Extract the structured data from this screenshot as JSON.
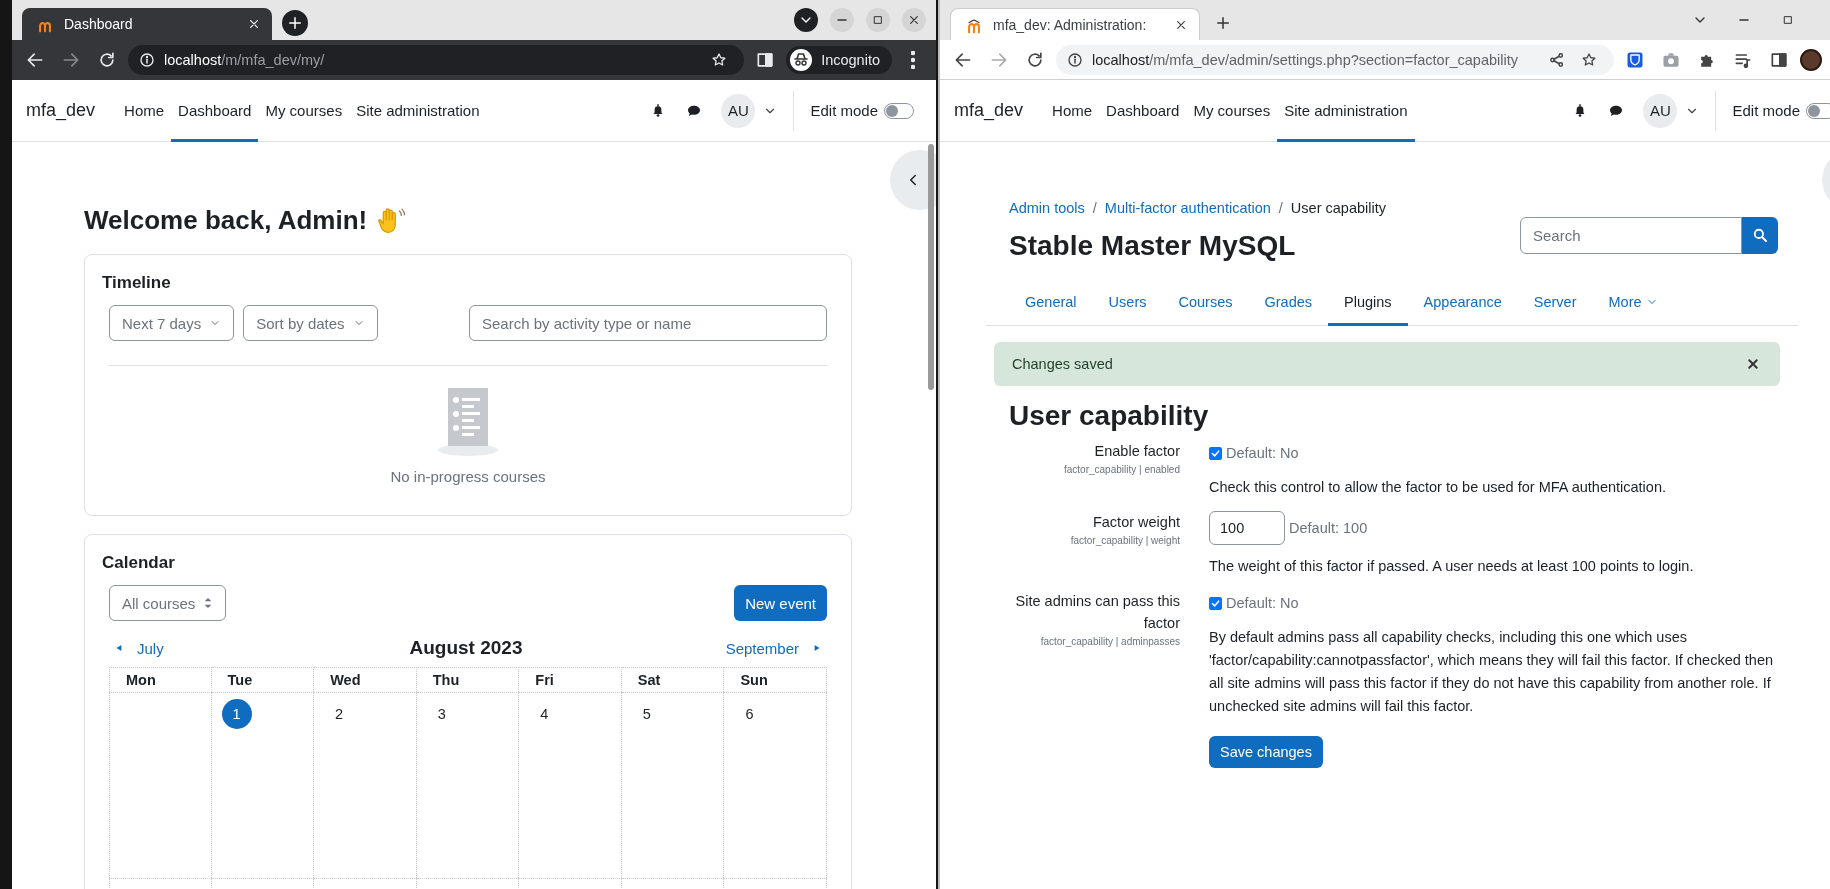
{
  "left_window": {
    "incognito": true,
    "tab": {
      "title": "Dashboard"
    },
    "address": {
      "host": "localhost",
      "path": "/m/mfa_dev/my/"
    },
    "profile_label": "Incognito",
    "navbar": {
      "site_name": "mfa_dev",
      "nav": [
        {
          "label": "Home",
          "selected": false
        },
        {
          "label": "Dashboard",
          "selected": true
        },
        {
          "label": "My courses",
          "selected": false
        },
        {
          "label": "Site administration",
          "selected": false
        }
      ],
      "avatar": "AU",
      "edit_mode": {
        "label": "Edit mode",
        "on": false
      }
    },
    "page": {
      "heading": "Welcome back, Admin!",
      "timeline": {
        "title": "Timeline",
        "filters": [
          "Next 7 days",
          "Sort by dates"
        ],
        "search": {
          "placeholder": "Search by activity type or name"
        },
        "empty_text": "No in-progress courses"
      },
      "calendar": {
        "title": "Calendar",
        "course_select": "All courses",
        "new_event": "New event",
        "previous": "July",
        "month": "August 2023",
        "next": "September",
        "weekdays": [
          "Mon",
          "Tue",
          "Wed",
          "Thu",
          "Fri",
          "Sat",
          "Sun"
        ],
        "days": [
          {
            "today": false
          },
          {
            "label": "1",
            "today": true
          },
          {
            "label": "2",
            "today": false
          },
          {
            "label": "3",
            "today": false
          },
          {
            "label": "4",
            "today": false
          },
          {
            "label": "5",
            "today": false
          },
          {
            "label": "6",
            "today": false
          }
        ]
      }
    }
  },
  "right_window": {
    "incognito": false,
    "tab": {
      "title": "mfa_dev: Administration:"
    },
    "address": {
      "host": "localhost",
      "path": "/m/mfa_dev/admin/settings.php?section=factor_capability"
    },
    "navbar": {
      "site_name": "mfa_dev",
      "nav": [
        {
          "label": "Home",
          "selected": false
        },
        {
          "label": "Dashboard",
          "selected": false
        },
        {
          "label": "My courses",
          "selected": false
        },
        {
          "label": "Site administration",
          "selected": true
        }
      ],
      "avatar": "AU",
      "edit_mode": {
        "label": "Edit mode",
        "on": false
      }
    },
    "page": {
      "breadcrumb": {
        "separator": "/",
        "items": [
          {
            "label": "Admin tools",
            "link": true
          },
          {
            "label": "Multi-factor authentication",
            "link": true
          },
          {
            "label": "User capability",
            "link": false
          }
        ]
      },
      "title": "Stable Master MySQL",
      "search": {
        "placeholder": "Search"
      },
      "tabs": [
        {
          "label": "General",
          "selected": false,
          "dropdown": false
        },
        {
          "label": "Users",
          "selected": false,
          "dropdown": false
        },
        {
          "label": "Courses",
          "selected": false,
          "dropdown": false
        },
        {
          "label": "Grades",
          "selected": false,
          "dropdown": false
        },
        {
          "label": "Plugins",
          "selected": true,
          "dropdown": false
        },
        {
          "label": "Appearance",
          "selected": false,
          "dropdown": false
        },
        {
          "label": "Server",
          "selected": false,
          "dropdown": false
        },
        {
          "label": "More",
          "selected": false,
          "dropdown": true
        }
      ],
      "alert": {
        "text": "Changes saved"
      },
      "heading": "User capability",
      "settings": [
        {
          "kind": "checkbox",
          "label": "Enable factor",
          "key": "factor_capability | enabled",
          "checked": true,
          "default": "Default: No",
          "description": "Check this control to allow the factor to be used for MFA authentication."
        },
        {
          "kind": "text",
          "label": "Factor weight",
          "key": "factor_capability | weight",
          "value": "100",
          "default": "Default: 100",
          "description": "The weight of this factor if passed. A user needs at least 100 points to login."
        },
        {
          "kind": "checkbox",
          "label": "Site admins can pass this factor",
          "key": "factor_capability | adminpasses",
          "checked": true,
          "default": "Default: No",
          "description": "By default admins pass all capability checks, including this one which uses 'factor/capability:cannotpassfactor', which means they will fail this factor. If checked then all site admins will pass this factor if they do not have this capability from another role. If unchecked site admins will fail this factor."
        }
      ],
      "save_button": "Save changes"
    }
  }
}
